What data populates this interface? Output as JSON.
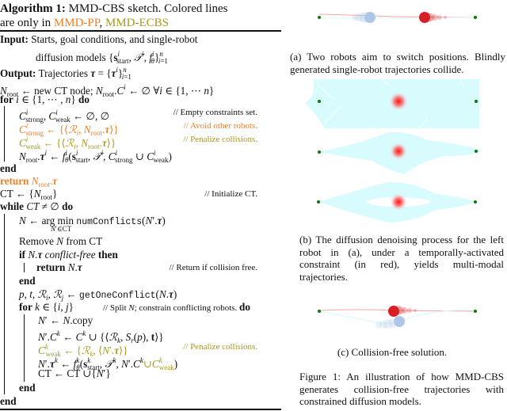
{
  "algorithm": {
    "label": "Algorithm 1:",
    "title": "MMD-CBS sketch.  Colored lines",
    "title_line2_prefix": "are only in ",
    "variant_pp": "MMD-PP",
    "variant_sep": ", ",
    "variant_ecbs": "MMD-ECBS",
    "input_label": "Input:",
    "input_text_1": "Starts, goal conditions, and single-robot",
    "input_text_2": "diffusion models {s",
    "output_label": "Output:",
    "output_text": "Trajectories τ = {τ",
    "lines": [
      {
        "id": "root_init",
        "text": "N_root ← new CT node; N_root.C^i ← ∅ ∀i ∈ {1, ⋯ n}"
      },
      {
        "id": "for_i",
        "kw": "for",
        "text": " i ∈ {1, ⋯ , n} ",
        "kw2": "do"
      },
      {
        "id": "empty",
        "text": "C^i_strong , C^i_weak ← ∅, ∅",
        "comment": "// Empty constraints set."
      },
      {
        "id": "strong",
        "text": "C^i_strong ← {⟨R_i , N_root.τ⟩}",
        "comment": "// Avoid other robots.",
        "color": "orange"
      },
      {
        "id": "weak",
        "text": "C^i_weak ← {⟨R_i , N_root.τ⟩}",
        "comment": "// Penalize collisions.",
        "color": "olive"
      },
      {
        "id": "sample",
        "text": "N_root.τ^i ← f^i_θ(s^i_start , T^i, C^i_strong ∪ C^i_weak)"
      },
      {
        "id": "end1",
        "kw": "end"
      },
      {
        "id": "return_root",
        "kw": "return",
        "text": " N_root.τ",
        "color": "orange"
      },
      {
        "id": "ct_init",
        "text": "CT ← {N_root}",
        "comment": "// Initialize CT."
      },
      {
        "id": "while",
        "kw": "while",
        "text": " CT ≠ ∅ ",
        "kw2": "do"
      },
      {
        "id": "argmin",
        "text": "N ← arg min",
        "func": "numConflicts",
        "args": "(N′.τ)",
        "under": "N′∈CT"
      },
      {
        "id": "remove",
        "text": "Remove N from CT"
      },
      {
        "id": "if",
        "kw": "if",
        "text": " N.τ ",
        "it": "conflict-free",
        "kw2": " then"
      },
      {
        "id": "return_n",
        "kw": "return",
        "text": " N.τ",
        "comment": "// Return if collision free."
      },
      {
        "id": "end2",
        "kw": "end"
      },
      {
        "id": "getconf",
        "text": "p, t, R_i , R_j ←",
        "func": "getOneConflict",
        "args": "(N.τ)"
      },
      {
        "id": "for_k",
        "kw": "for",
        "text": " k ∈ {i, j}",
        "comment": "// Split N; constrain conflicting robots.",
        "kw2": "do"
      },
      {
        "id": "copy",
        "text": "N′ ← N.copy"
      },
      {
        "id": "addc",
        "text": "N′.C^k ← C^k ∪ {⟨R_k , S_r(p), t⟩}"
      },
      {
        "id": "weak_k",
        "text": "C^k_weak ← {R_k , ⟨N′.τ⟩}",
        "comment": "// Penalize collisions.",
        "color": "olive"
      },
      {
        "id": "sample_k",
        "text": "N′.τ^k ← f^k_θ(s^k_start , T^k, N′.C^k ∪ C^k_weak)"
      },
      {
        "id": "ct_add",
        "text": "CT ← CT ∪{N′}"
      },
      {
        "id": "end3",
        "kw": "end"
      },
      {
        "id": "end4",
        "kw": "end"
      }
    ]
  },
  "figure": {
    "caption_a": "(a) Two robots aim to switch positions. Blindly generated single-robot trajectories collide.",
    "caption_b": "(b) The diffusion denoising process for the left robot in (a), under a temporally-activated constraint (in red), yields multi-modal trajectories.",
    "caption_c": "(c) Collision-free solution.",
    "caption_main": "Figure 1: An illustration of how MMD-CBS generates collision-free trajectories with constrained diffusion models.",
    "colors": {
      "goal_dot": "#0a7a0a",
      "robot_red": "#d62028",
      "robot_blue": "#aec7e8",
      "trajectory_cyan": "#d8fbfd",
      "constraint_red": "#ff2020",
      "orange_text": "#f47d20",
      "olive_text": "#a6991a"
    }
  }
}
